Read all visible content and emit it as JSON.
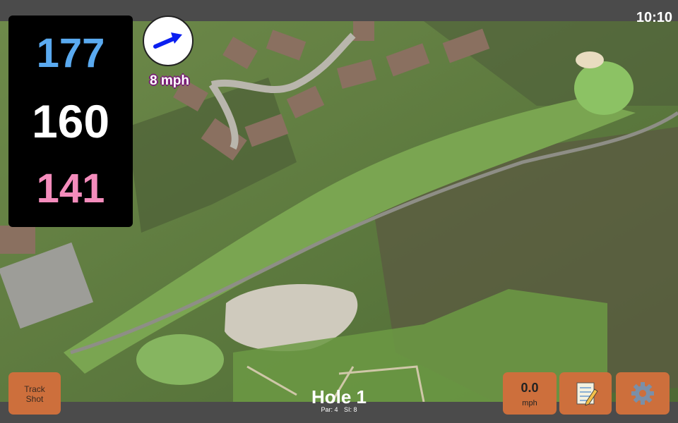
{
  "status": {
    "time": "10:10"
  },
  "distances": {
    "back": "177",
    "middle": "160",
    "front": "141"
  },
  "wind": {
    "speed_label": "8 mph",
    "icon": "wind-arrow-icon"
  },
  "buttons": {
    "track_shot_line1": "Track",
    "track_shot_line2": "Shot",
    "speed_value": "0.0",
    "speed_unit": "mph",
    "notes_icon": "notepad-icon",
    "settings_icon": "gear-icon"
  },
  "hole": {
    "title": "Hole 1",
    "par": "Par: 4",
    "si": "SI: 8"
  },
  "colors": {
    "back": "#5aaaf0",
    "middle": "#ffffff",
    "front": "#f48cbc",
    "button": "#cd6f3c"
  }
}
